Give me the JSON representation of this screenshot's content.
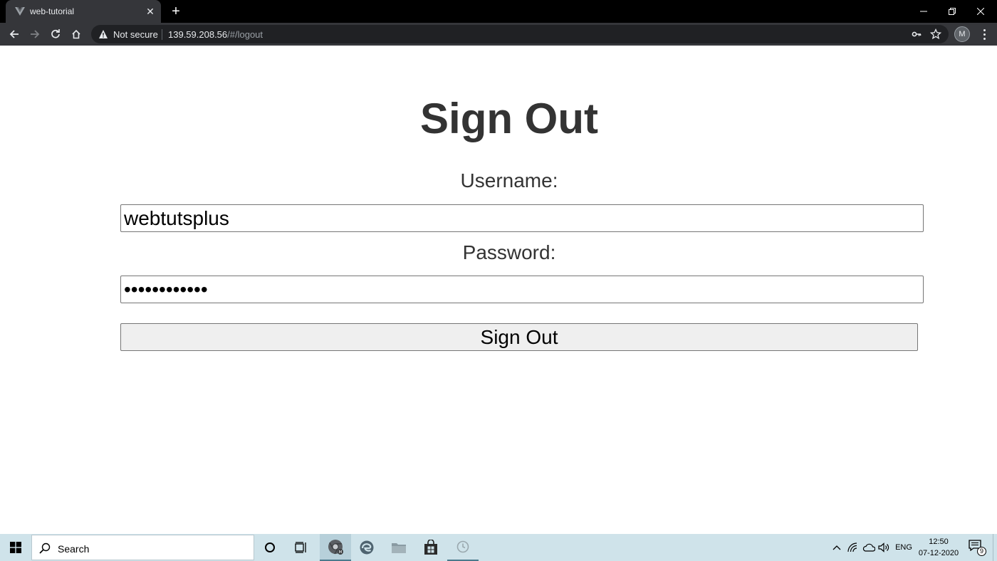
{
  "browser": {
    "tab_title": "web-tutorial",
    "tab_close": "✕",
    "new_tab": "+",
    "security_label": "Not secure",
    "url_host": "139.59.208.56",
    "url_path": "/#/logout",
    "profile_initial": "M"
  },
  "page": {
    "title": "Sign Out",
    "username_label": "Username:",
    "username_value": "webtutsplus",
    "password_label": "Password:",
    "password_value": "webtutsplus1",
    "submit_label": "Sign Out"
  },
  "taskbar": {
    "search_placeholder": "Search",
    "language": "ENG",
    "time": "12:50",
    "date": "07-12-2020",
    "notification_count": "9"
  },
  "colors": {
    "chrome_bar": "#35363a",
    "title_bar": "#000000",
    "heading_text": "#333333",
    "taskbar": "#cfe3ea"
  }
}
